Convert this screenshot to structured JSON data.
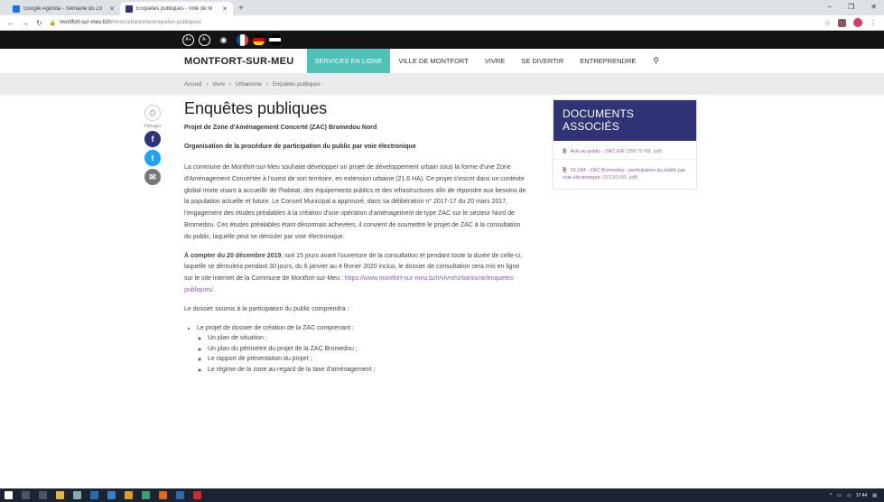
{
  "browser": {
    "tabs": [
      {
        "title": "Google Agenda - Semaine du 23",
        "favicon_color": "#1a73e8"
      },
      {
        "title": "Enquêtes publiques - Ville de M",
        "favicon_color": "#2e3475"
      }
    ],
    "url_domain": "montfort-sur-meu.bzh",
    "url_path": "/vivre/urbanisme/enquetes-publiques/"
  },
  "accessibility": {
    "font_plus": "A+",
    "font_minus": "A-"
  },
  "nav": {
    "logo": "MONTFORT-SUR-MEU",
    "items": [
      "SERVICES EN LIGNE",
      "VILLE DE MONTFORT",
      "VIVRE",
      "SE DIVERTIR",
      "ENTREPRENDRE"
    ],
    "accent": "#4fc1b7"
  },
  "breadcrumb": [
    "Accueil",
    "Vivre",
    "Urbanisme",
    "Enquêtes publiques"
  ],
  "share": {
    "label": "Partager"
  },
  "article": {
    "title": "Enquêtes publiques",
    "subtitle1": "Projet de Zone d'Aménagement Concerté (ZAC) Bromedou Nord",
    "subtitle2": "Organisation de la procédure de participation du public par voie électronique",
    "para1": "La commune de Montfort-sur-Meu souhaite développer un projet de développement urbain sous la forme d'une Zone d'Aménagement Concertée à l'ouest de son territoire, en extension urbaine (21.6 HA). Ce projet s'inscrit dans un contexte global mixte visant à accueillir de l'habitat, des équipements publics et des infrastructures afin de répondre aux besoins de la population actuelle et future. Le Conseil Municipal a approuvé, dans sa délibération n° 2017-17 du 20 mars 2017, l'engagement des études préalables à la création d'une opération d'aménagement de type ZAC sur le secteur Nord de Bromedou. Ces études préalables étant désormais achevées, il convient de soumettre le projet de ZAC à la consultation du public, laquelle peut se dérouler par voie électronique.",
    "para2_bold": "À compter du 20 décembre 2019",
    "para2": ", soit 15 jours avant l'ouverture de la consultation et pendant toute la durée de celle-ci, laquelle se déroulera pendant 30 jours, du 6 janvier au 4 février 2020 inclus, le dossier de consultation sera mis en ligne sur le site internet de la Commune de Montfort-sur-Meu : ",
    "para2_link": "https://www.montfort-sur-meu.bzh/vivre/urbanisme/enquetes-publiques/",
    "para3": "Le dossier soumis à la participation du public comprendra :",
    "list_item": "Le projet de dossier de création de la ZAC comprenant :",
    "sublist": [
      "Un plan de situation ;",
      "Un plan du périmètre du projet de la ZAC Bromedou ;",
      "Le rapport de présentation du projet ;",
      "Le régime de la zone au regard de la taxe d'aménagement ;"
    ]
  },
  "docs": {
    "heading": "DOCUMENTS ASSOCIÉS",
    "items": [
      {
        "title": "Avis au public - ZAC EIE",
        "meta": " (358,79 KB, pdf)"
      },
      {
        "title": "19-184 - ZAC Bromedou - participation du public par voie électronique",
        "meta": " (323,93 KB, pdf)"
      }
    ]
  },
  "taskbar": {
    "time": "17:44"
  }
}
